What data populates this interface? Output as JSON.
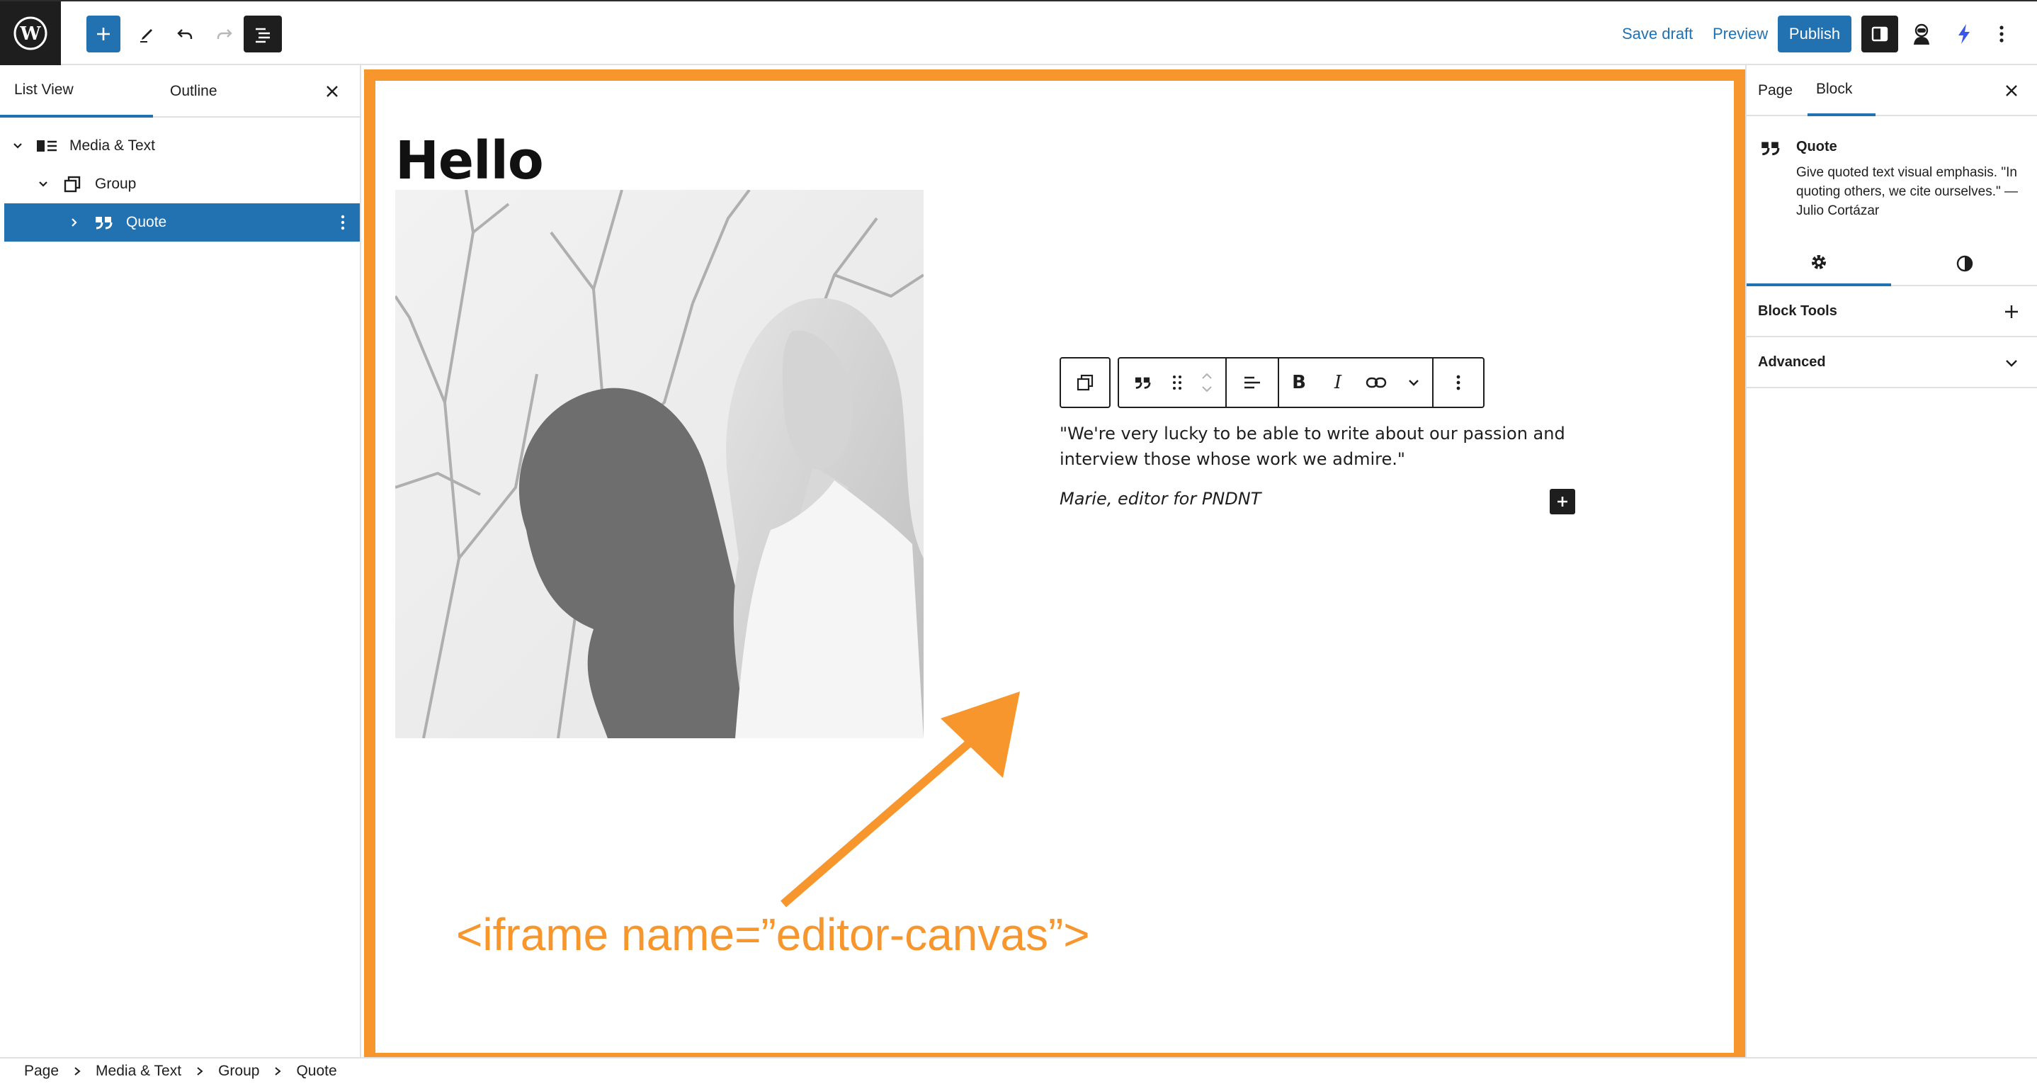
{
  "topbar": {
    "save_draft": "Save draft",
    "preview": "Preview",
    "publish": "Publish"
  },
  "left_panel": {
    "tabs": [
      {
        "label": "List View",
        "active": true
      },
      {
        "label": "Outline",
        "active": false
      }
    ],
    "tree": [
      {
        "label": "Media & Text",
        "icon": "media-text-icon",
        "expanded": true
      },
      {
        "label": "Group",
        "icon": "group-icon",
        "expanded": true
      },
      {
        "label": "Quote",
        "icon": "quote-icon",
        "expanded": false,
        "selected": true
      }
    ]
  },
  "canvas": {
    "title": "Hello",
    "image": "black-and-white photo of a woman with long hair in front of bare branches",
    "quote_text": "\"We're very lucky to be able to write about our passion and interview those whose work we admire.\"",
    "quote_cite": "Marie, editor for PNDNT",
    "annotation": "<iframe name=”editor-canvas”>",
    "frame_color": "#f7962c"
  },
  "right_panel": {
    "tabs": [
      {
        "label": "Page",
        "active": false
      },
      {
        "label": "Block",
        "active": true
      }
    ],
    "block_card": {
      "title": "Quote",
      "description": "Give quoted text visual emphasis. \"In quoting others, we cite ourselves.\" — Julio Cortázar"
    },
    "sections": [
      {
        "label": "Block Tools",
        "icon": "plus-icon"
      },
      {
        "label": "Advanced",
        "icon": "chevron-down-icon"
      }
    ]
  },
  "breadcrumb": [
    "Page",
    "Media & Text",
    "Group",
    "Quote"
  ],
  "colors": {
    "accent": "#2271b1",
    "dark": "#1e1e1e",
    "annotation": "#f7962c"
  }
}
